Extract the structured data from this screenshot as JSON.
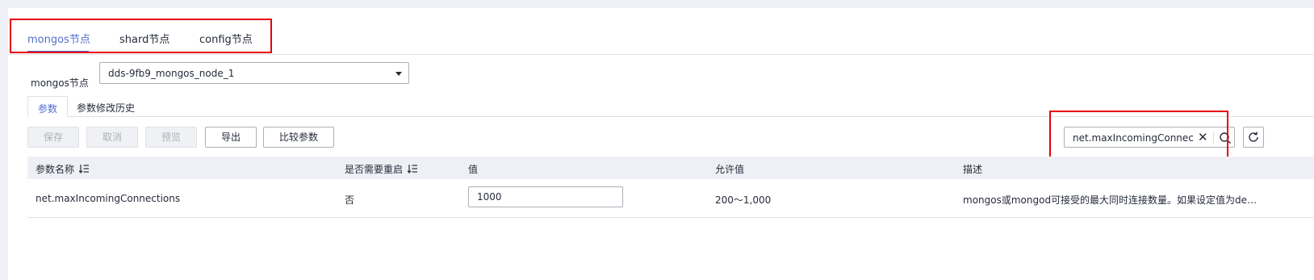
{
  "tabs": [
    {
      "label": "mongos节点",
      "active": true
    },
    {
      "label": "shard节点",
      "active": false
    },
    {
      "label": "config节点",
      "active": false
    }
  ],
  "node_selector": {
    "label": "mongos节点",
    "value": "dds-9fb9_mongos_node_1"
  },
  "subtabs": [
    {
      "label": "参数",
      "active": true
    },
    {
      "label": "参数修改历史",
      "active": false
    }
  ],
  "toolbar": {
    "save_label": "保存",
    "cancel_label": "取消",
    "preview_label": "预览",
    "export_label": "导出",
    "compare_label": "比较参数"
  },
  "search": {
    "value": "net.maxIncomingConnections"
  },
  "table": {
    "columns": [
      "参数名称",
      "是否需要重启",
      "值",
      "允许值",
      "描述"
    ],
    "rows": [
      {
        "name": "net.maxIncomingConnections",
        "restart": "否",
        "value": "1000",
        "allowed": "200～1,000",
        "description": "mongos或mongod可接受的最大同时连接数量。如果设定值为default..."
      }
    ]
  },
  "colors": {
    "accent": "#526ecc",
    "highlight": "#e6000a",
    "header_bg": "#eef0f5"
  }
}
